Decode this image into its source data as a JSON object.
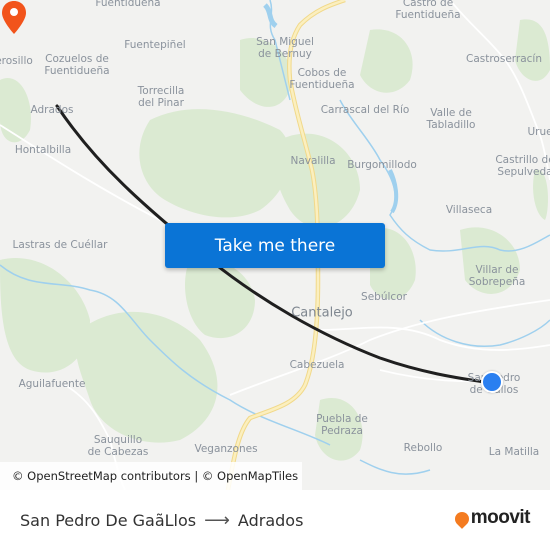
{
  "map": {
    "places": [
      {
        "id": "fuentiduena-top",
        "label": "Fuentidueña"
      },
      {
        "id": "castro",
        "label": "Castro de\nFuentidueña"
      },
      {
        "id": "san-miguel",
        "label": "San Miguel\nde Bernuy"
      },
      {
        "id": "fuentepinel",
        "label": "Fuentepiñel"
      },
      {
        "id": "castroserracin",
        "label": "Castroserracín"
      },
      {
        "id": "cerosillo",
        "label": "erosillo"
      },
      {
        "id": "cozuelos",
        "label": "Cozuelos de\nFuentidueña"
      },
      {
        "id": "cobos",
        "label": "Cobos de\nFuentidueña"
      },
      {
        "id": "torrecilla",
        "label": "Torrecilla\ndel Pinar"
      },
      {
        "id": "adrados",
        "label": "Adrados"
      },
      {
        "id": "carrascal",
        "label": "Carrascal del Río"
      },
      {
        "id": "valle",
        "label": "Valle de\nTabladillo"
      },
      {
        "id": "urue",
        "label": "Urue"
      },
      {
        "id": "hontalbilla",
        "label": "Hontalbilla"
      },
      {
        "id": "navalilla",
        "label": "Navalilla"
      },
      {
        "id": "burgomillodo",
        "label": "Burgomillodo"
      },
      {
        "id": "castrillo",
        "label": "Castrillo de\nSepulveda"
      },
      {
        "id": "villaseca",
        "label": "Villaseca"
      },
      {
        "id": "lastras",
        "label": "Lastras de Cuéllar"
      },
      {
        "id": "villar",
        "label": "Villar de\nSobrepeña"
      },
      {
        "id": "sebulcor",
        "label": "Sebúlcor"
      },
      {
        "id": "cantalejo",
        "label": "Cantalejo"
      },
      {
        "id": "cabezuela",
        "label": "Cabezuela"
      },
      {
        "id": "san-pedro",
        "label": "San Pedro\nde Gallos"
      },
      {
        "id": "aguilafuente",
        "label": "Aguilafuente"
      },
      {
        "id": "puebla",
        "label": "Puebla de\nPedraza"
      },
      {
        "id": "sauquillo",
        "label": "Sauquillo\nde Cabezas"
      },
      {
        "id": "rebollo",
        "label": "Rebollo"
      },
      {
        "id": "la-matilla",
        "label": "La Matilla"
      },
      {
        "id": "veganzones",
        "label": "Veganzones"
      }
    ],
    "cta_label": "Take me there",
    "attribution": "© OpenStreetMap contributors | © OpenMapTiles",
    "colors": {
      "route_line": "#1f1f1f",
      "destination_pin": "#f2541b",
      "origin_dot": "#2a7ff0",
      "cta_bg": "#0a74d6",
      "forest": "#d9ead0",
      "water": "#9fd0ee",
      "major_road": "#f7e59b"
    }
  },
  "footer": {
    "origin": "San Pedro De GaãLlos",
    "arrow": "⟶",
    "destination": "Adrados",
    "brand": "moovit",
    "brand_color": "#f47b20"
  }
}
